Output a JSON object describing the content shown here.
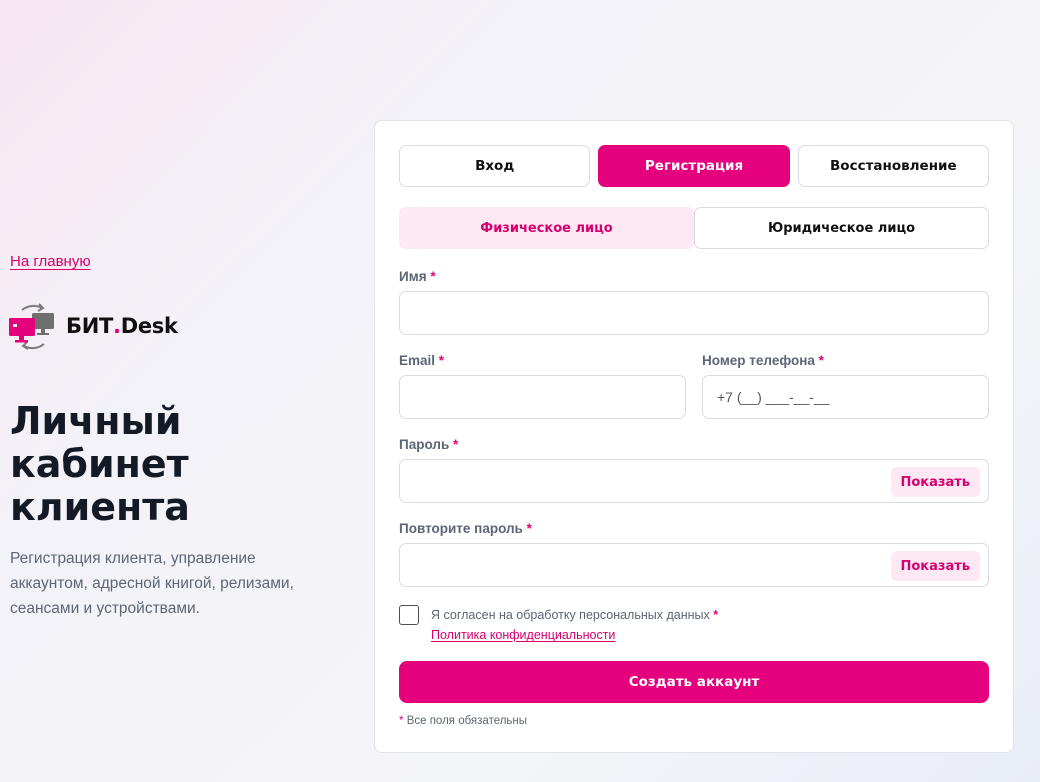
{
  "left": {
    "back_link": "На главную",
    "logo": {
      "name_main": "БИТ",
      "name_dot": ".",
      "name_suffix": "Desk"
    },
    "title": "Личный кабинет клиента",
    "subtitle": "Регистрация клиента, управление аккаунтом, адресной книгой, релизами, сеансами и устройствами."
  },
  "tabs": [
    {
      "label": "Вход",
      "active": false
    },
    {
      "label": "Регистрация",
      "active": true
    },
    {
      "label": "Восстановление",
      "active": false
    }
  ],
  "subtabs": [
    {
      "label": "Физическое лицо",
      "active": true
    },
    {
      "label": "Юридическое лицо",
      "active": false
    }
  ],
  "form": {
    "name": {
      "label": "Имя",
      "required_mark": "*",
      "value": ""
    },
    "email": {
      "label": "Email",
      "required_mark": "*",
      "value": ""
    },
    "phone": {
      "label": "Номер телефона",
      "required_mark": "*",
      "placeholder": "+7 (__) ___-__-__"
    },
    "password": {
      "label": "Пароль",
      "required_mark": "*",
      "show_label": "Показать"
    },
    "password_repeat": {
      "label": "Повторите пароль",
      "required_mark": "*",
      "show_label": "Показать"
    },
    "consent": {
      "text": "Я согласен на обработку персональных данных",
      "required_mark": "*",
      "checked": false
    },
    "policy_link": "Политика конфиденциальности",
    "submit_label": "Создать аккаунт",
    "required_note": {
      "mark": "*",
      "text": "Все поля обязательны"
    }
  },
  "colors": {
    "accent": "#e5007d",
    "accent_light": "#fde8f3",
    "text_muted": "#5b6576"
  }
}
